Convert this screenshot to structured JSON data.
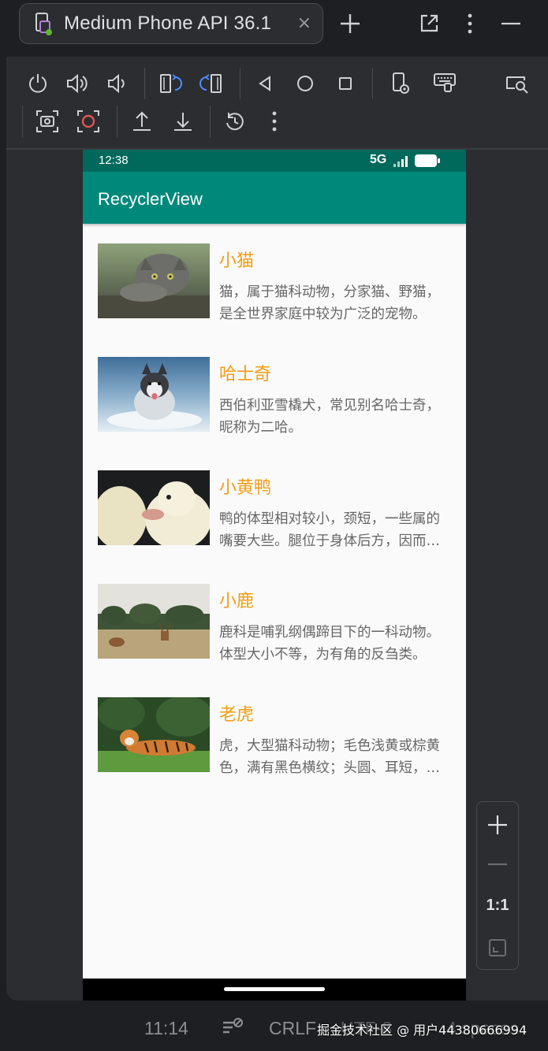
{
  "window": {
    "tab_title": "Medium Phone API 36.1",
    "close_glyph": "×",
    "icons": [
      "device-running-icon",
      "add-icon",
      "external-window-icon",
      "more-vertical-icon",
      "minimize-icon"
    ]
  },
  "toolbar": {
    "icons": [
      "power-icon",
      "volume-up-icon",
      "volume-down-icon",
      "rotate-left-icon",
      "rotate-right-icon",
      "back-icon",
      "home-icon",
      "overview-icon",
      "device-settings-icon",
      "keyboard-icon",
      "zoom-screen-icon",
      "screenshot-icon",
      "record-icon",
      "upload-icon",
      "download-icon",
      "reset-icon",
      "more-vertical-icon"
    ]
  },
  "phone": {
    "status_time": "12:38",
    "network": "5G",
    "app_title": "RecyclerView",
    "items": [
      {
        "name": "小猫",
        "desc": "猫，属于猫科动物，分家猫、野猫，是全世界家庭中较为广泛的宠物。",
        "image": "cat-photo"
      },
      {
        "name": "哈士奇",
        "desc": "西伯利亚雪橇犬，常见别名哈士奇，昵称为二哈。",
        "image": "husky-photo"
      },
      {
        "name": "小黄鸭",
        "desc": "鸭的体型相对较小，颈短，一些属的嘴要大些。腿位于身体后方，因而步态蹒跚。",
        "image": "duckling-photo"
      },
      {
        "name": "小鹿",
        "desc": "鹿科是哺乳纲偶蹄目下的一科动物。体型大小不等，为有角的反刍类。",
        "image": "deer-photo"
      },
      {
        "name": "老虎",
        "desc": "虎，大型猫科动物；毛色浅黄或棕黄色，满有黑色横纹；头圆、耳短，耳背面黑色。",
        "image": "tiger-photo"
      }
    ]
  },
  "zoom": {
    "ratio_label": "1:1"
  },
  "statusbar": {
    "position": "11:14",
    "line_ending": "CRLF",
    "encoding": "UTF-8",
    "indent": "4 spaces",
    "watermark": "掘金技术社区 @ 用户44380666994"
  },
  "colors": {
    "app_bar": "#00897b",
    "status_bar": "#00695c",
    "item_title": "#f39c12",
    "ide_bg": "#1e1f22"
  }
}
